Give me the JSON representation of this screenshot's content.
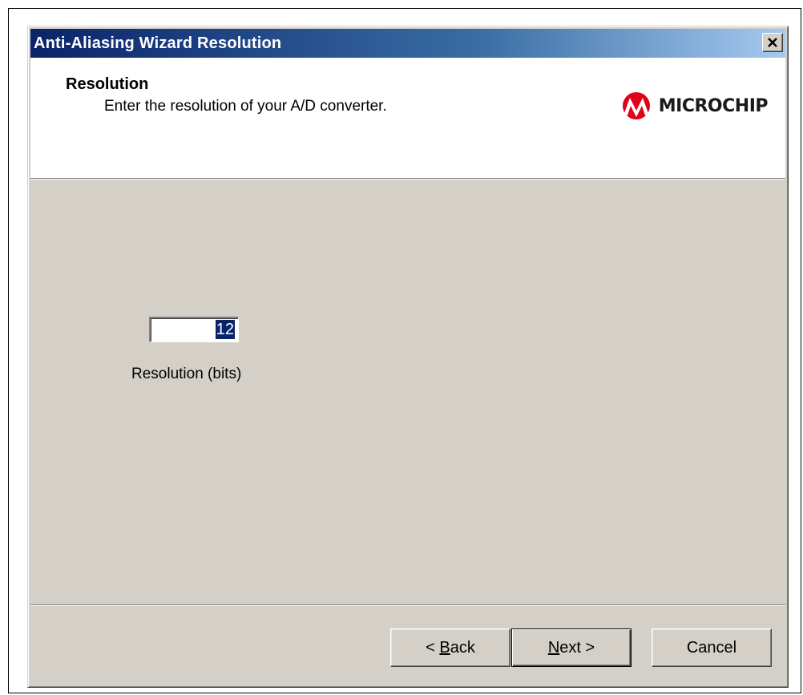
{
  "window": {
    "title": "Anti-Aliasing Wizard Resolution",
    "close_label": "X"
  },
  "header": {
    "title": "Resolution",
    "subtitle": "Enter the resolution of your A/D converter.",
    "logo_text": "MICROCHIP",
    "logo_color": "#e3001b"
  },
  "form": {
    "resolution_value": "12",
    "resolution_label": "Resolution (bits)"
  },
  "buttons": {
    "back_prefix": "< ",
    "back_mnemonic": "B",
    "back_rest": "ack",
    "next_mnemonic": "N",
    "next_rest": "ext >",
    "cancel": "Cancel"
  },
  "colors": {
    "titlebar_start": "#0a246a",
    "titlebar_end": "#a6caf0",
    "dialog_face": "#d4d0c8",
    "selection": "#0a246a"
  }
}
